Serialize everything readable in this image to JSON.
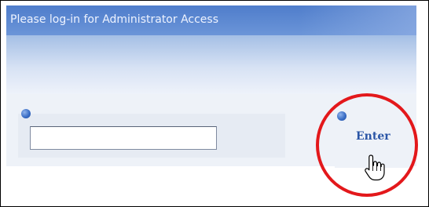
{
  "login": {
    "title": "Please log-in for Administrator Access",
    "password_field": {
      "value": "",
      "placeholder": ""
    },
    "enter_label": "Enter"
  },
  "colors": {
    "title_bar": "#4f7dcb",
    "title_text": "#eef3ff",
    "button_text": "#2a55a6",
    "highlight_ring": "#e3181b"
  },
  "icons": {
    "bullet": "blue-bullet-icon",
    "cursor": "hand-pointer-icon"
  }
}
